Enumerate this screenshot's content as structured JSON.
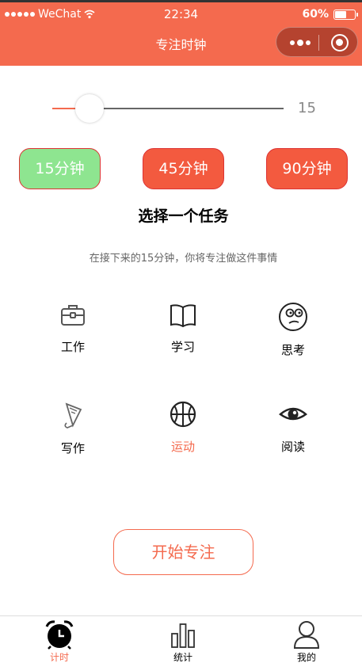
{
  "status": {
    "carrier": "WeChat",
    "time": "22:34",
    "battery": "60%",
    "battery_level": 0.6
  },
  "nav": {
    "title": "专注时钟"
  },
  "slider": {
    "value": "15",
    "min": 0,
    "max": 120,
    "level": 0.16
  },
  "presets": [
    {
      "label": "15分钟",
      "color": "#8ee590"
    },
    {
      "label": "45分钟",
      "color": "#f35a3f"
    },
    {
      "label": "90分钟",
      "color": "#f35a3f"
    }
  ],
  "main": {
    "title": "选择一个任务",
    "subtitle": "在接下来的15分钟，你将专注做这件事情"
  },
  "tasks": [
    {
      "label": "工作",
      "icon": "briefcase-icon"
    },
    {
      "label": "学习",
      "icon": "book-icon"
    },
    {
      "label": "思考",
      "icon": "thinking-face-icon"
    },
    {
      "label": "写作",
      "icon": "writing-icon"
    },
    {
      "label": "运动",
      "icon": "basketball-icon",
      "active": true
    },
    {
      "label": "阅读",
      "icon": "eye-icon"
    }
  ],
  "start_button": {
    "label": "开始专注"
  },
  "tabbar": [
    {
      "label": "计时",
      "icon": "alarm-clock-icon",
      "active": true
    },
    {
      "label": "统计",
      "icon": "bar-chart-icon"
    },
    {
      "label": "我的",
      "icon": "user-icon"
    }
  ],
  "colors": {
    "accent": "#f46a4e",
    "preset_selected": "#8ee590",
    "preset": "#f35a3f"
  }
}
